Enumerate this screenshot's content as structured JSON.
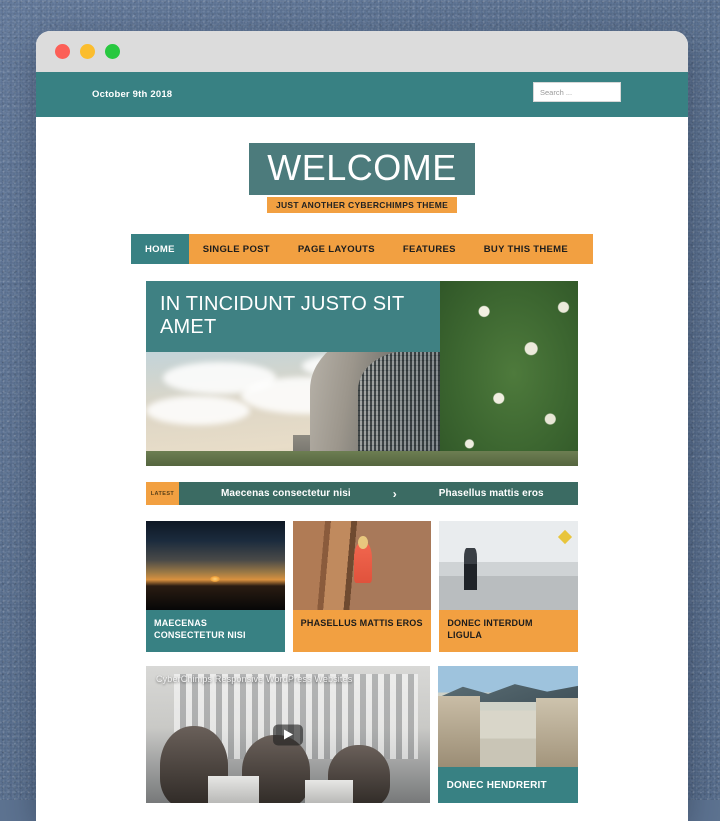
{
  "theme": {
    "teal": "#388183",
    "orange": "#f2a041",
    "backdrop": "#5d7391"
  },
  "window": {
    "traffic_lights": [
      {
        "name": "close",
        "color": "#fc5f57"
      },
      {
        "name": "minimize",
        "color": "#fbbd2e"
      },
      {
        "name": "maximize",
        "color": "#28c840"
      }
    ]
  },
  "topbar": {
    "date": "October 9th 2018",
    "search_placeholder": "Search ..."
  },
  "brand": {
    "title": "WELCOME",
    "tagline": "JUST ANOTHER CYBERCHIMPS THEME"
  },
  "nav": {
    "items": [
      {
        "label": "HOME",
        "active": true
      },
      {
        "label": "SINGLE POST",
        "active": false
      },
      {
        "label": "PAGE LAYOUTS",
        "active": false
      },
      {
        "label": "FEATURES",
        "active": false
      },
      {
        "label": "BUY THIS THEME",
        "active": false
      }
    ]
  },
  "hero": {
    "title": "IN TINCIDUNT JUSTO SIT AMET",
    "image_alt": "modern curved glass building with clouds and blossoming tree"
  },
  "ticker": {
    "badge": "LATEST",
    "item_1": "Maecenas consectetur nisi",
    "arrow": "›",
    "item_2": "Phasellus mattis eros"
  },
  "cards": [
    {
      "caption": "MAECENAS CONSECTETUR NISI",
      "style": "teal",
      "image_alt": "sunset over dark landscape"
    },
    {
      "caption": "PHASELLUS MATTIS EROS",
      "style": "orange",
      "image_alt": "girl in red dress by wooden fence"
    },
    {
      "caption": "DONEC INTERDUM LIGULA",
      "style": "orange",
      "image_alt": "people walking on city street"
    }
  ],
  "video": {
    "title": "CyberChimps Responsive WordPress Websites",
    "play_icon": "play-icon"
  },
  "village": {
    "caption": "DONEC HENDRERIT",
    "image_alt": "village street with mountain"
  },
  "scroll_top": {
    "icon": "chevron-up-icon"
  }
}
